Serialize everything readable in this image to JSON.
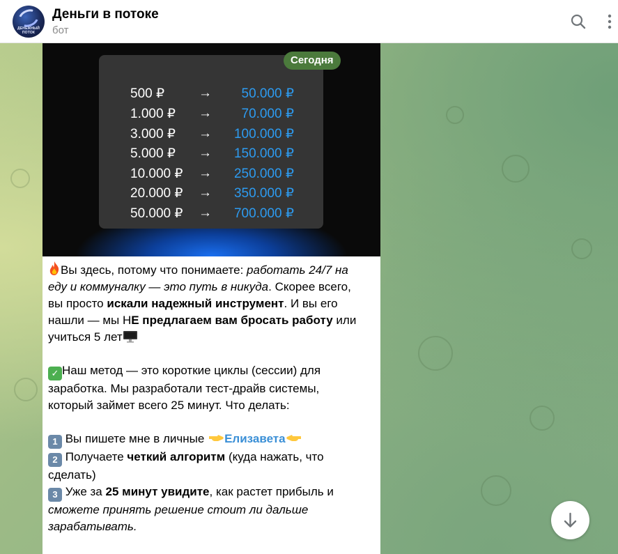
{
  "header": {
    "title": "Деньги в потоке",
    "subtitle": "бот",
    "avatar_text": "ДЕНЕЖНЫЙ ПОТОК",
    "icons": [
      "search-icon",
      "more-vertical-icon"
    ]
  },
  "media": {
    "date_badge": "Сегодня",
    "arrow": "→",
    "rates": [
      {
        "from": "500 ₽",
        "to": "50.000 ₽"
      },
      {
        "from": "1.000 ₽",
        "to": "70.000 ₽"
      },
      {
        "from": "3.000 ₽",
        "to": "100.000 ₽"
      },
      {
        "from": "5.000 ₽",
        "to": "150.000 ₽"
      },
      {
        "from": "10.000 ₽",
        "to": "250.000 ₽"
      },
      {
        "from": "20.000 ₽",
        "to": "350.000 ₽"
      },
      {
        "from": "50.000 ₽",
        "to": "700.000 ₽"
      }
    ]
  },
  "message": {
    "p1": {
      "l1a": "Вы здесь, потому что понимаете: ",
      "l1b": "работать 24/7 на",
      "l2a": "еду и коммуналку — это путь в никуда",
      "l2b": ". Скорее всего,",
      "l3a": "вы просто ",
      "l3b": "искали надежный инструмент",
      "l3c": ". И вы его",
      "l4a": "нашли — мы Н",
      "l4b": "Е предлагаем вам бросать работу",
      "l4c": " или",
      "l5": "учиться 5 лет"
    },
    "p2": {
      "l1": "Наш метод — это короткие циклы (сессии) для",
      "l2": "заработка. Мы разработали тест-драйв системы,",
      "l3": "который займет всего 25 минут. Что делать:"
    },
    "steps": {
      "s1_num": "1",
      "s1a": " Вы пишете мне в личные ",
      "s1_link": "Елизавета",
      "s2_num": "2",
      "s2a": " Получаете ",
      "s2b": "четкий алгоритм",
      "s2c": " (куда нажать, что",
      "s2d": "сделать)",
      "s3_num": "3",
      "s3a": " Уже за ",
      "s3b": "25 минут увидите",
      "s3c": ", как растет прибыль и",
      "s3d": "сможете принять решение стоит ли дальше",
      "s3e": "зарабатывать."
    }
  },
  "colors": {
    "accent_blue": "#2d9bf0",
    "badge_green": "#4b7a3c",
    "link": "#3a8fd6"
  }
}
